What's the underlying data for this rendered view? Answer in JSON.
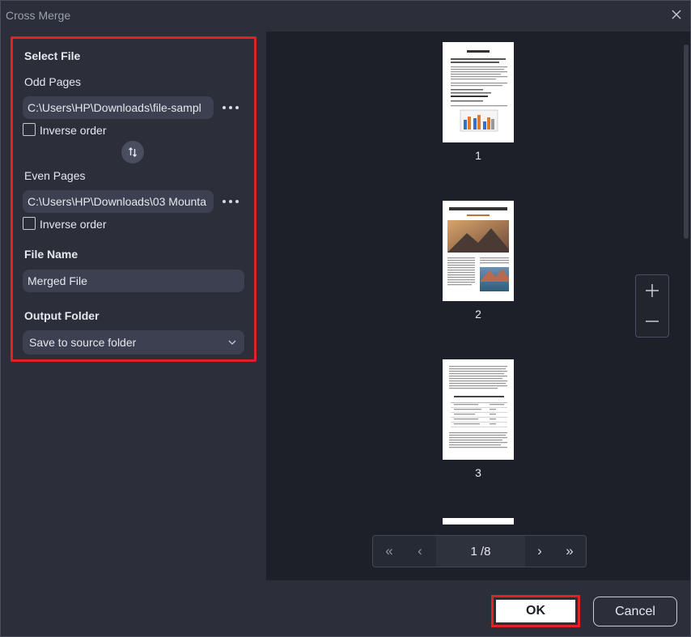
{
  "window": {
    "title": "Cross Merge"
  },
  "left_panel": {
    "select_file_heading": "Select File",
    "odd_pages_label": "Odd Pages",
    "odd_pages_value": "C:\\Users\\HP\\Downloads\\file-sampl",
    "odd_inverse_label": "Inverse order",
    "even_pages_label": "Even Pages",
    "even_pages_value": "C:\\Users\\HP\\Downloads\\03 Mounta",
    "even_inverse_label": "Inverse order",
    "file_name_heading": "File Name",
    "file_name_value": "Merged File",
    "output_folder_heading": "Output Folder",
    "output_folder_selected": "Save to source folder"
  },
  "preview": {
    "pages": [
      {
        "number": "1",
        "heading": "Lorem Ipsum"
      },
      {
        "number": "2",
        "heading": "HOW ARE MOUNTAINS FORMED?"
      },
      {
        "number": "3",
        "heading": ""
      }
    ],
    "page_indicator": "1 /8",
    "nav_first": "«",
    "nav_prev": "‹",
    "nav_next": "›",
    "nav_last": "»"
  },
  "footer": {
    "ok_label": "OK",
    "cancel_label": "Cancel"
  },
  "colors": {
    "highlight": "#e0202a",
    "background": "#2c2f3a",
    "preview_bg": "#1d2029"
  }
}
